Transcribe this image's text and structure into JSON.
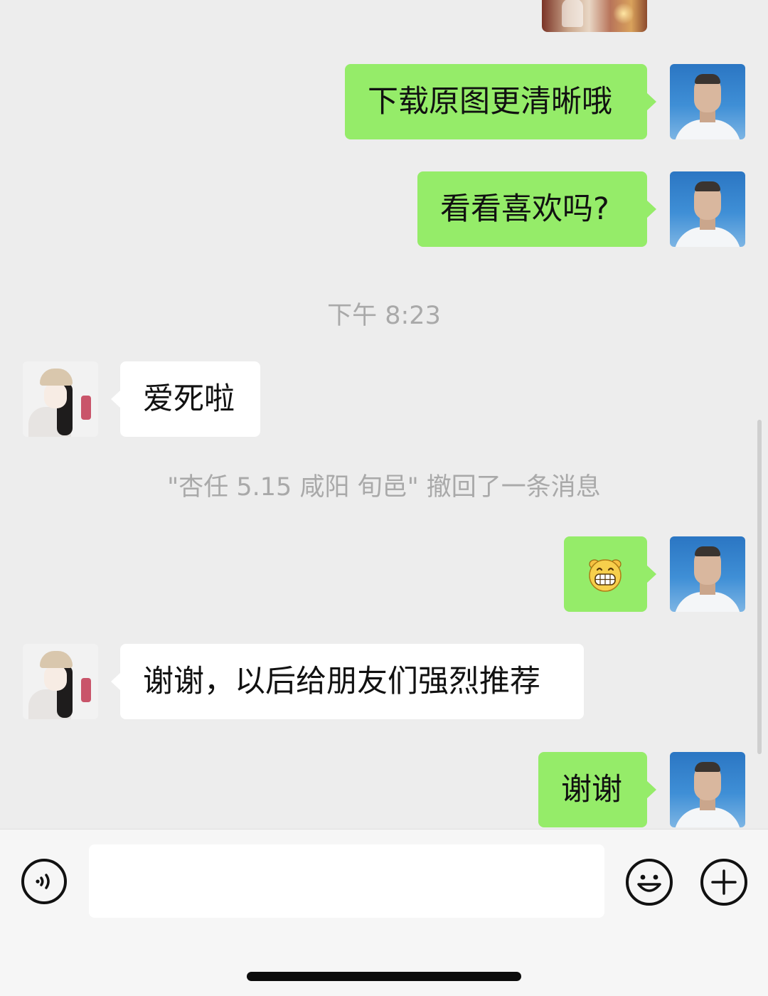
{
  "chat": {
    "messages": [
      {
        "sender": "me",
        "type": "image"
      },
      {
        "sender": "me",
        "type": "text",
        "text": "下载原图更清晰哦"
      },
      {
        "sender": "me",
        "type": "text",
        "text": "看看喜欢吗?"
      },
      {
        "type": "timestamp",
        "text": "下午 8:23"
      },
      {
        "sender": "friend",
        "type": "text",
        "text": "爱死啦"
      },
      {
        "type": "recall",
        "text": "\"杏任 5.15 咸阳 旬邑\" 撤回了一条消息"
      },
      {
        "sender": "me",
        "type": "emoji",
        "emoji": "grinning-face"
      },
      {
        "sender": "friend",
        "type": "text",
        "text": "谢谢，以后给朋友们强烈推荐"
      },
      {
        "sender": "me",
        "type": "text",
        "text": "谢谢"
      }
    ]
  },
  "input_bar": {
    "message_value": "",
    "voice_icon": "voice-icon",
    "emoji_icon": "emoji-icon",
    "plus_icon": "plus-icon"
  },
  "colors": {
    "background": "#ededed",
    "my_bubble": "#95ec69",
    "friend_bubble": "#ffffff",
    "system_text": "#a9a9a9"
  }
}
